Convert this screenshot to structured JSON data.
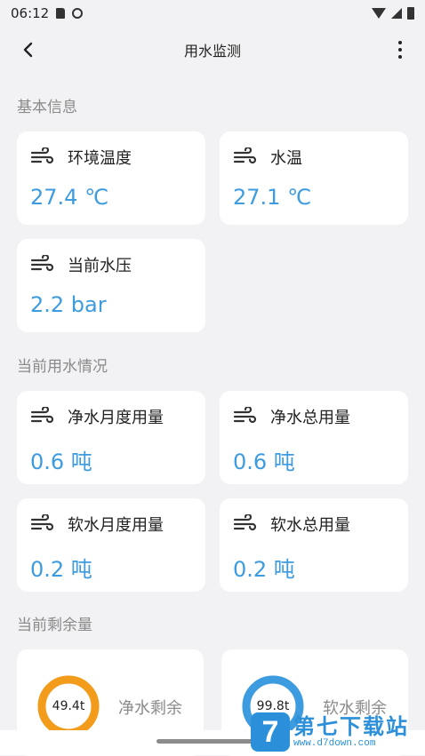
{
  "status_bar": {
    "time": "06:12"
  },
  "app_bar": {
    "title": "用水监测"
  },
  "sections": {
    "basic": "基本信息",
    "usage": "当前用水情况",
    "remaining": "当前剩余量"
  },
  "basic_cards": [
    {
      "label": "环境温度",
      "value": "27.4 ℃"
    },
    {
      "label": "水温",
      "value": "27.1 ℃"
    },
    {
      "label": "当前水压",
      "value": "2.2 bar"
    }
  ],
  "usage_cards": [
    {
      "label": "净水月度用量",
      "value": "0.6 吨"
    },
    {
      "label": "净水总用量",
      "value": "0.6 吨"
    },
    {
      "label": "软水月度用量",
      "value": "0.2 吨"
    },
    {
      "label": "软水总用量",
      "value": "0.2 吨"
    }
  ],
  "remaining_cards": [
    {
      "label": "净水剩余",
      "value": "49.4t",
      "ring_color": "#f39c1c",
      "fraction": 1.0
    },
    {
      "label": "软水剩余",
      "value": "99.8t",
      "ring_color": "#3d9be0",
      "fraction": 1.0
    }
  ],
  "watermark": {
    "logo": "7",
    "title": "第七下载站",
    "url": "www.d7down.com"
  },
  "colors": {
    "accent": "#3d9be0",
    "background": "#f2f2f4"
  },
  "icons": [
    "sd-card-icon",
    "face-icon",
    "wifi-icon",
    "signal-icon",
    "battery-icon",
    "back-icon",
    "more-icon",
    "wind-icon"
  ]
}
